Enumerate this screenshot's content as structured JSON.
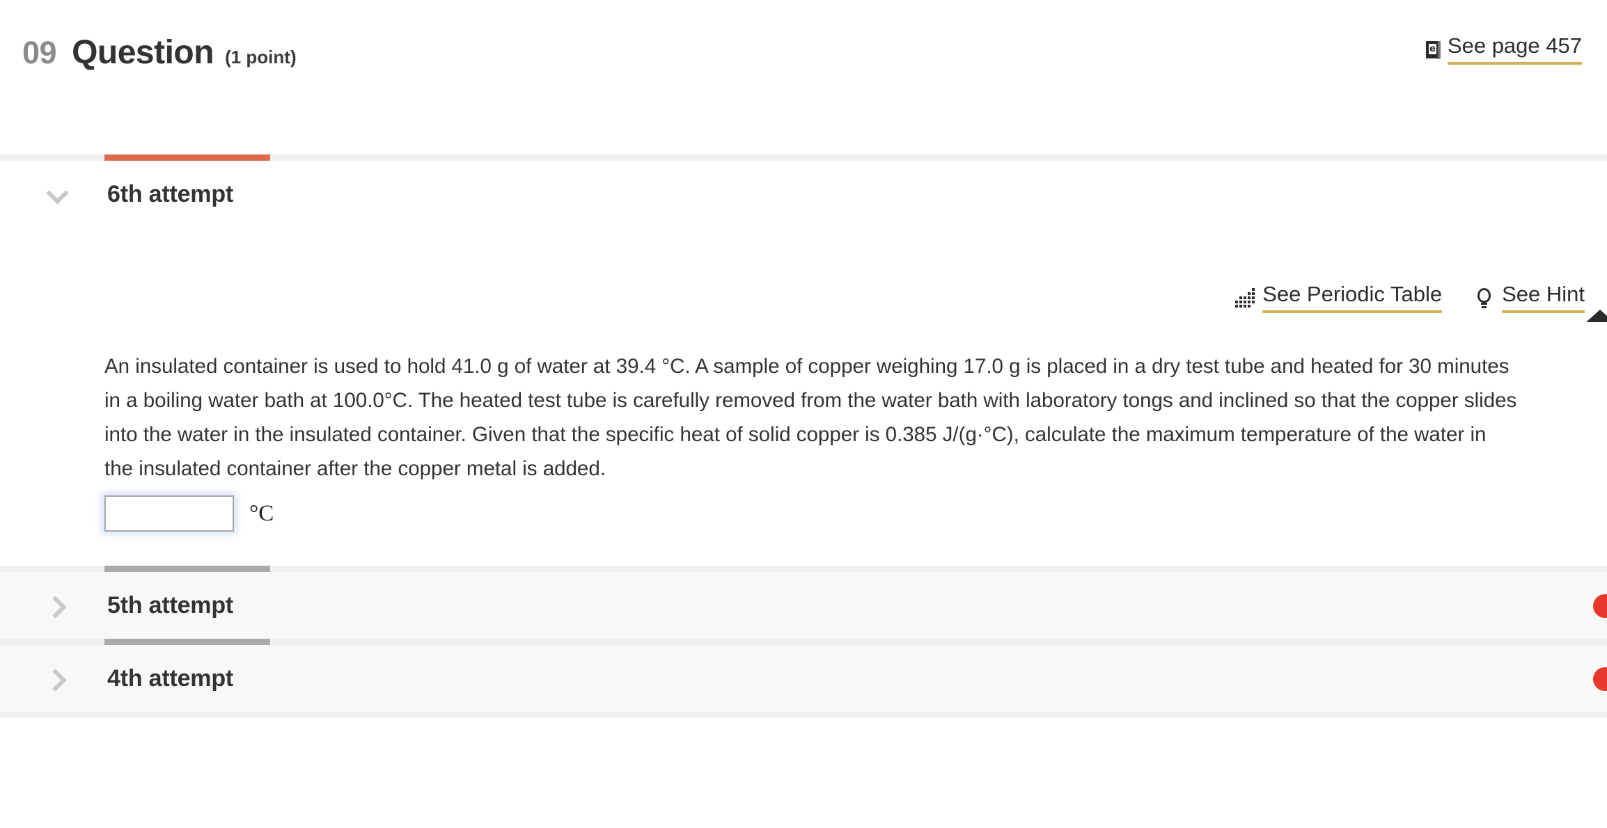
{
  "header": {
    "question_number": "09",
    "question_label": "Question",
    "points": "(1 point)",
    "see_page_label": "See page 457",
    "ebook_icon_letter": "e",
    "ebook_icon_name": "ebook-icon"
  },
  "colors": {
    "accent_orange": "#dd6a4a",
    "underline_gold": "#d4b355",
    "divider_gray": "#aaaaaa",
    "strip_bg": "#efefef",
    "status_red": "#e8382b"
  },
  "tools": {
    "periodic_table_label": "See Periodic Table",
    "hint_label": "See Hint"
  },
  "attempts": [
    {
      "title": "6th attempt",
      "state": "expanded",
      "chevron": "chevron-down-icon"
    },
    {
      "title": "5th attempt",
      "state": "collapsed",
      "chevron": "chevron-right-icon"
    },
    {
      "title": "4th attempt",
      "state": "collapsed",
      "chevron": "chevron-right-icon"
    }
  ],
  "question": {
    "text": "An insulated container is used to hold 41.0  g of water at 39.4 °C. A sample of copper weighing 17.0  g is placed in a dry test tube and heated for 30 minutes in a boiling water bath at 100.0°C. The heated test tube is carefully removed from the water bath with laboratory tongs and inclined so that the copper slides into the water in the insulated container. Given that the specific heat of solid copper is 0.385 J/(g·°C), calculate the maximum temperature of the water in the insulated container after the copper metal is added.",
    "values": {
      "mass_water_g": "41.0",
      "initial_water_temp_C": "39.4",
      "mass_copper_g": "17.0",
      "heating_time_min": "30",
      "bath_temp_C": "100.0",
      "specific_heat_copper": "0.385",
      "specific_heat_units": "J/(g·°C)"
    },
    "answer_value": "",
    "answer_placeholder": "",
    "answer_unit": "°C"
  }
}
